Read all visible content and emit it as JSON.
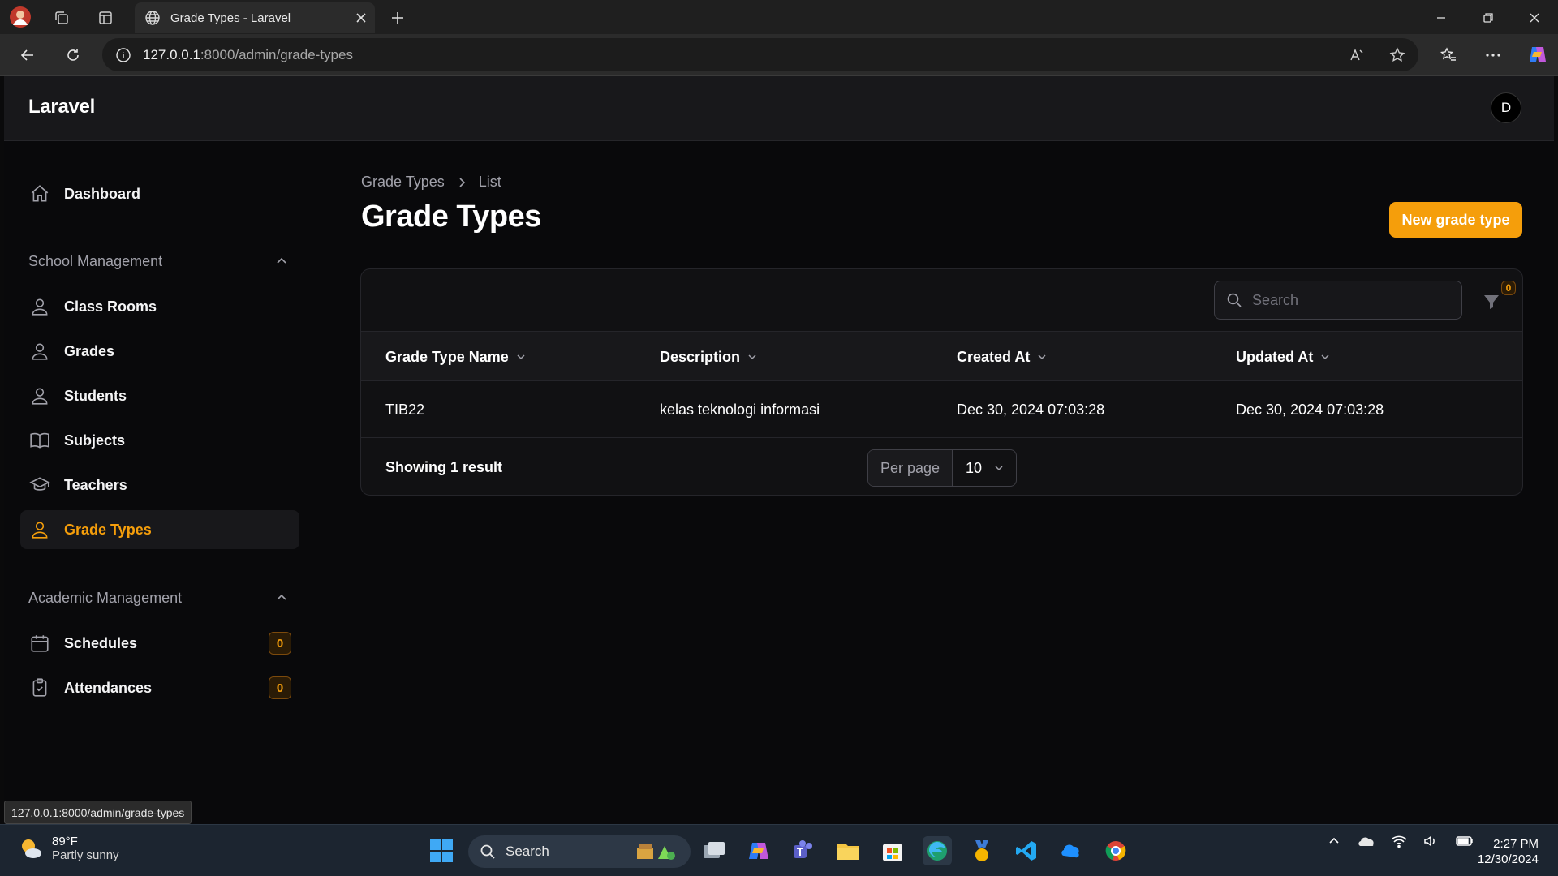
{
  "browser": {
    "tab_title": "Grade Types - Laravel",
    "url_host": "127.0.0.1",
    "url_rest": ":8000/admin/grade-types",
    "status_url": "127.0.0.1:8000/admin/grade-types"
  },
  "app": {
    "brand": "Laravel",
    "avatar_initial": "D"
  },
  "sidebar": {
    "dashboard": "Dashboard",
    "groups": [
      {
        "label": "School Management",
        "items": [
          {
            "label": "Class Rooms",
            "icon": "user-icon"
          },
          {
            "label": "Grades",
            "icon": "user-icon"
          },
          {
            "label": "Students",
            "icon": "user-icon"
          },
          {
            "label": "Subjects",
            "icon": "book-icon"
          },
          {
            "label": "Teachers",
            "icon": "academic-cap-icon"
          },
          {
            "label": "Grade Types",
            "icon": "user-icon",
            "active": true
          }
        ]
      },
      {
        "label": "Academic Management",
        "items": [
          {
            "label": "Schedules",
            "icon": "calendar-icon",
            "badge": "0"
          },
          {
            "label": "Attendances",
            "icon": "clipboard-check-icon",
            "badge": "0"
          }
        ]
      }
    ]
  },
  "page": {
    "breadcrumb": [
      "Grade Types",
      "List"
    ],
    "title": "Grade Types",
    "new_button": "New grade type"
  },
  "table": {
    "search_placeholder": "Search",
    "filter_count": "0",
    "columns": [
      "Grade Type Name",
      "Description",
      "Created At",
      "Updated At"
    ],
    "rows": [
      [
        "TIB22",
        "kelas teknologi informasi",
        "Dec 30, 2024 07:03:28",
        "Dec 30, 2024 07:03:28"
      ]
    ],
    "showing": "Showing 1 result",
    "per_page_label": "Per page",
    "per_page_value": "10"
  },
  "taskbar": {
    "temperature": "89°F",
    "condition": "Partly sunny",
    "search_label": "Search",
    "time": "2:27 PM",
    "date": "12/30/2024"
  },
  "colors": {
    "accent": "#f59e0b",
    "background": "#09090b",
    "surface": "#18181b"
  }
}
